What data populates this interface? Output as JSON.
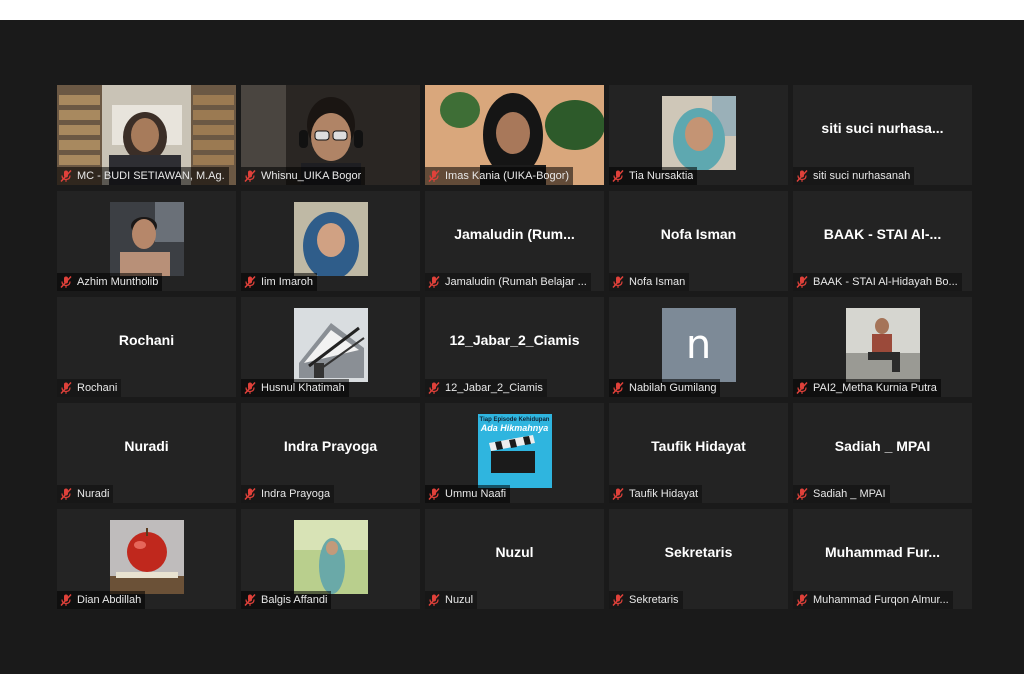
{
  "participants": [
    {
      "name": "MC - BUDI SETIAWAN, M.Ag.",
      "display": "",
      "video": "library"
    },
    {
      "name": "Whisnu_UIKA Bogor",
      "display": "",
      "video": "headset"
    },
    {
      "name": "Imas Kania (UIKA-Bogor)",
      "display": "",
      "video": "plant",
      "speaking": true
    },
    {
      "name": "Tia Nursaktia",
      "display": "",
      "video": "hijab-teal"
    },
    {
      "name": "siti suci nurhasanah",
      "display": "siti suci nurhasa...",
      "video": ""
    },
    {
      "name": "Azhim Muntholib",
      "display": "",
      "video": "car"
    },
    {
      "name": "Iim Imaroh",
      "display": "",
      "video": "hijab-blue"
    },
    {
      "name": "Jamaludin (Rumah Belajar ...",
      "display": "Jamaludin  (Rum...",
      "video": ""
    },
    {
      "name": "Nofa Isman",
      "display": "Nofa Isman",
      "video": ""
    },
    {
      "name": "BAAK - STAI Al-Hidayah Bo...",
      "display": "BAAK - STAI Al-...",
      "video": ""
    },
    {
      "name": "Rochani",
      "display": "Rochani",
      "video": ""
    },
    {
      "name": "Husnul Khatimah",
      "display": "",
      "video": "building"
    },
    {
      "name": "12_Jabar_2_Ciamis",
      "display": "12_Jabar_2_Ciamis",
      "video": ""
    },
    {
      "name": "Nabilah Gumilang",
      "display": "",
      "video": "letter-n",
      "letter": "n"
    },
    {
      "name": "PAI2_Metha Kurnia Putra",
      "display": "",
      "video": "sitting"
    },
    {
      "name": "Nuradi",
      "display": "Nuradi",
      "video": ""
    },
    {
      "name": "Indra Prayoga",
      "display": "Indra Prayoga",
      "video": ""
    },
    {
      "name": "Ummu Naafi",
      "display": "",
      "video": "poster",
      "poster_line1": "Tiap Episode Kehidupan",
      "poster_line2": "Ada Hikmahnya"
    },
    {
      "name": "Taufik Hidayat",
      "display": "Taufik Hidayat",
      "video": ""
    },
    {
      "name": "Sadiah _ MPAI",
      "display": "Sadiah _ MPAI",
      "video": ""
    },
    {
      "name": "Dian Abdillah",
      "display": "",
      "video": "apple"
    },
    {
      "name": "Balgis Affandi",
      "display": "",
      "video": "outdoor"
    },
    {
      "name": "Nuzul",
      "display": "Nuzul",
      "video": ""
    },
    {
      "name": "Sekretaris",
      "display": "Sekretaris",
      "video": ""
    },
    {
      "name": "Muhammad Furqon Almur...",
      "display": "Muhammad  Fur...",
      "video": ""
    }
  ],
  "icons": {
    "mic": "muted-mic-icon"
  },
  "colors": {
    "speaking_border": "#9fd33a",
    "muted_icon": "#e0413a",
    "tile_bg": "#232323",
    "stage_bg": "#1a1a1a"
  }
}
